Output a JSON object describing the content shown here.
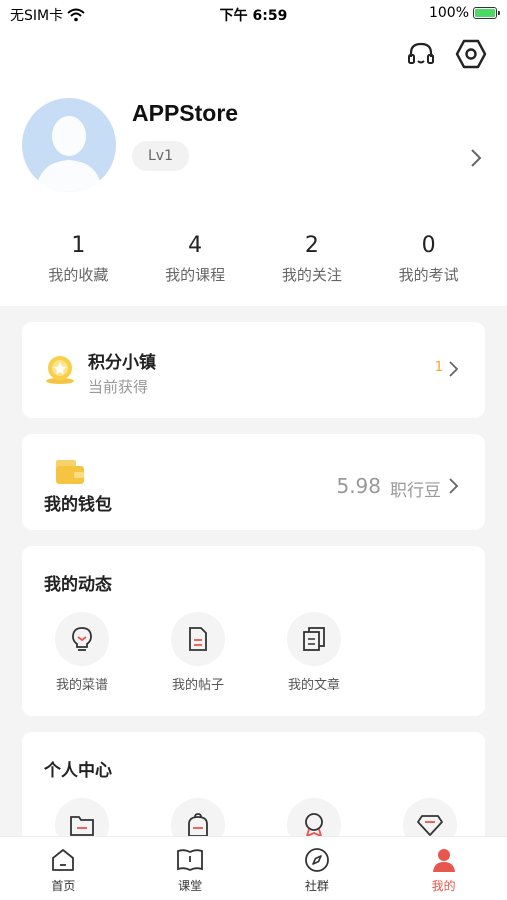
{
  "status_bar": {
    "carrier": "无SIM卡",
    "time": "下午 6:59",
    "battery": "100%"
  },
  "header": {
    "icons": [
      "headset-icon",
      "settings-hex-icon"
    ]
  },
  "profile": {
    "username": "APPStore",
    "level": "Lv1"
  },
  "stats": [
    {
      "value": "1",
      "label": "我的收藏"
    },
    {
      "value": "4",
      "label": "我的课程"
    },
    {
      "value": "2",
      "label": "我的关注"
    },
    {
      "value": "0",
      "label": "我的考试"
    }
  ],
  "points": {
    "title": "积分小镇",
    "subtitle": "当前获得",
    "value": "1"
  },
  "wallet": {
    "title": "我的钱包",
    "value": "5.98",
    "unit": "职行豆"
  },
  "activity": {
    "title": "我的动态",
    "items": [
      {
        "label": "我的菜谱",
        "icon": "bulb-icon"
      },
      {
        "label": "我的帖子",
        "icon": "document-icon"
      },
      {
        "label": "我的文章",
        "icon": "articles-icon"
      }
    ]
  },
  "personal_center": {
    "title": "个人中心",
    "icons": [
      "folder-icon",
      "backpack-icon",
      "badge-icon",
      "diamond-icon"
    ]
  },
  "tabbar": [
    {
      "label": "首页",
      "icon": "home-icon",
      "active": false
    },
    {
      "label": "课堂",
      "icon": "book-icon",
      "active": false
    },
    {
      "label": "社群",
      "icon": "compass-icon",
      "active": false
    },
    {
      "label": "我的",
      "icon": "person-icon",
      "active": true
    }
  ],
  "colors": {
    "accent": "#e8574f",
    "points": "#f5a623",
    "avatar_bg": "#c7dcf5"
  }
}
